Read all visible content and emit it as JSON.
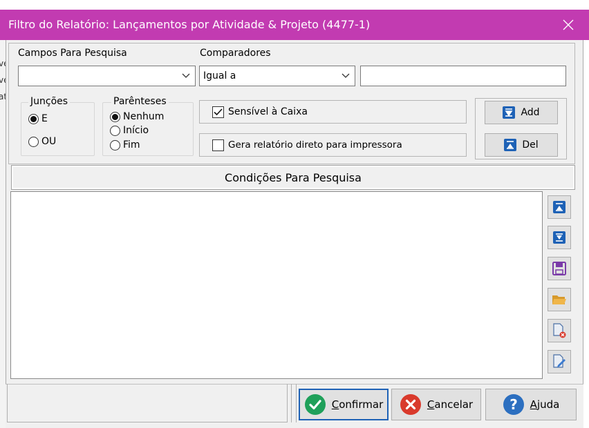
{
  "window": {
    "title": "Filtro do Relatório: Lançamentos por Atividade & Projeto (4477-1)",
    "close_icon": "close-icon"
  },
  "background_fragments": [
    "ve",
    "ve",
    "at"
  ],
  "fields": {
    "campos_label": "Campos Para Pesquisa",
    "campos_value": "",
    "comparadores_label": "Comparadores",
    "comparadores_value": "Igual a",
    "value_text": ""
  },
  "juncoes": {
    "title": "Junções",
    "options": [
      "E",
      "OU"
    ],
    "selected": "E"
  },
  "parenteses": {
    "title": "Parênteses",
    "options": [
      "Nenhum",
      "Início",
      "Fim"
    ],
    "selected": "Nenhum"
  },
  "checkboxes": {
    "sensivel": {
      "label": "Sensível à Caixa",
      "checked": true
    },
    "gera": {
      "label": "Gera relatório direto para impressora",
      "checked": false
    }
  },
  "buttons": {
    "add": "Add",
    "del": "Del"
  },
  "conditions": {
    "header": "Condições Para Pesquisa",
    "items": []
  },
  "side_tools": [
    "move-up-icon",
    "move-down-icon",
    "save-icon",
    "open-folder-icon",
    "delete-file-icon",
    "edit-file-icon"
  ],
  "actions": {
    "confirmar": {
      "label": "Confirmar",
      "underline": "C",
      "rest": "onfirmar"
    },
    "cancelar": {
      "label": "Cancelar",
      "underline": "C",
      "rest": "ancelar"
    },
    "ajuda": {
      "label": "Ajuda",
      "underline": "A",
      "rest": "juda"
    }
  },
  "colors": {
    "titlebar": "#c23bb1",
    "accent_blue": "#1e62b6",
    "confirm_green": "#1fa05a",
    "cancel_red": "#d93a2c",
    "help_blue": "#2c6fc0"
  }
}
